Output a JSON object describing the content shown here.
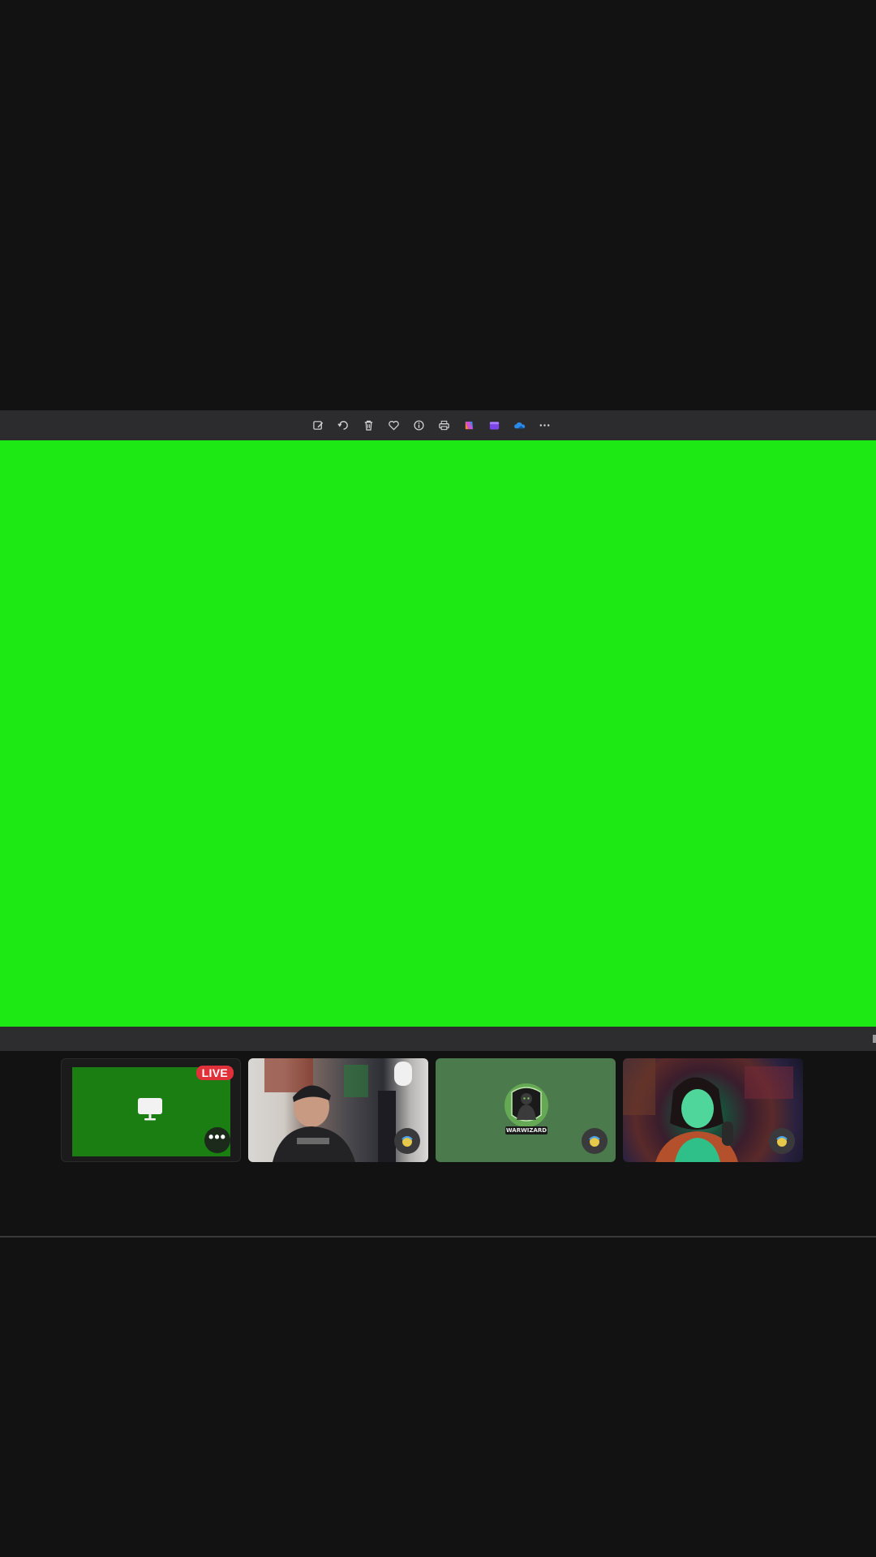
{
  "toolbar": {
    "icons": [
      {
        "name": "edit-icon"
      },
      {
        "name": "rotate-icon"
      },
      {
        "name": "delete-icon"
      },
      {
        "name": "favorite-icon"
      },
      {
        "name": "info-icon"
      },
      {
        "name": "print-icon"
      },
      {
        "name": "copilot-icon"
      },
      {
        "name": "clipchamp-icon"
      },
      {
        "name": "onedrive-icon"
      },
      {
        "name": "more-icon"
      }
    ]
  },
  "stage": {
    "background_color": "#1de915"
  },
  "tiles": [
    {
      "type": "screen-share",
      "badge": "LIVE",
      "more_label": "•••"
    },
    {
      "type": "webcam"
    },
    {
      "type": "avatar",
      "logo_text": "WARWIZARD"
    },
    {
      "type": "webcam"
    }
  ],
  "colors": {
    "live_badge": "#e0303a",
    "toolbar_bg": "#2c2c2e",
    "page_bg": "#121213"
  }
}
